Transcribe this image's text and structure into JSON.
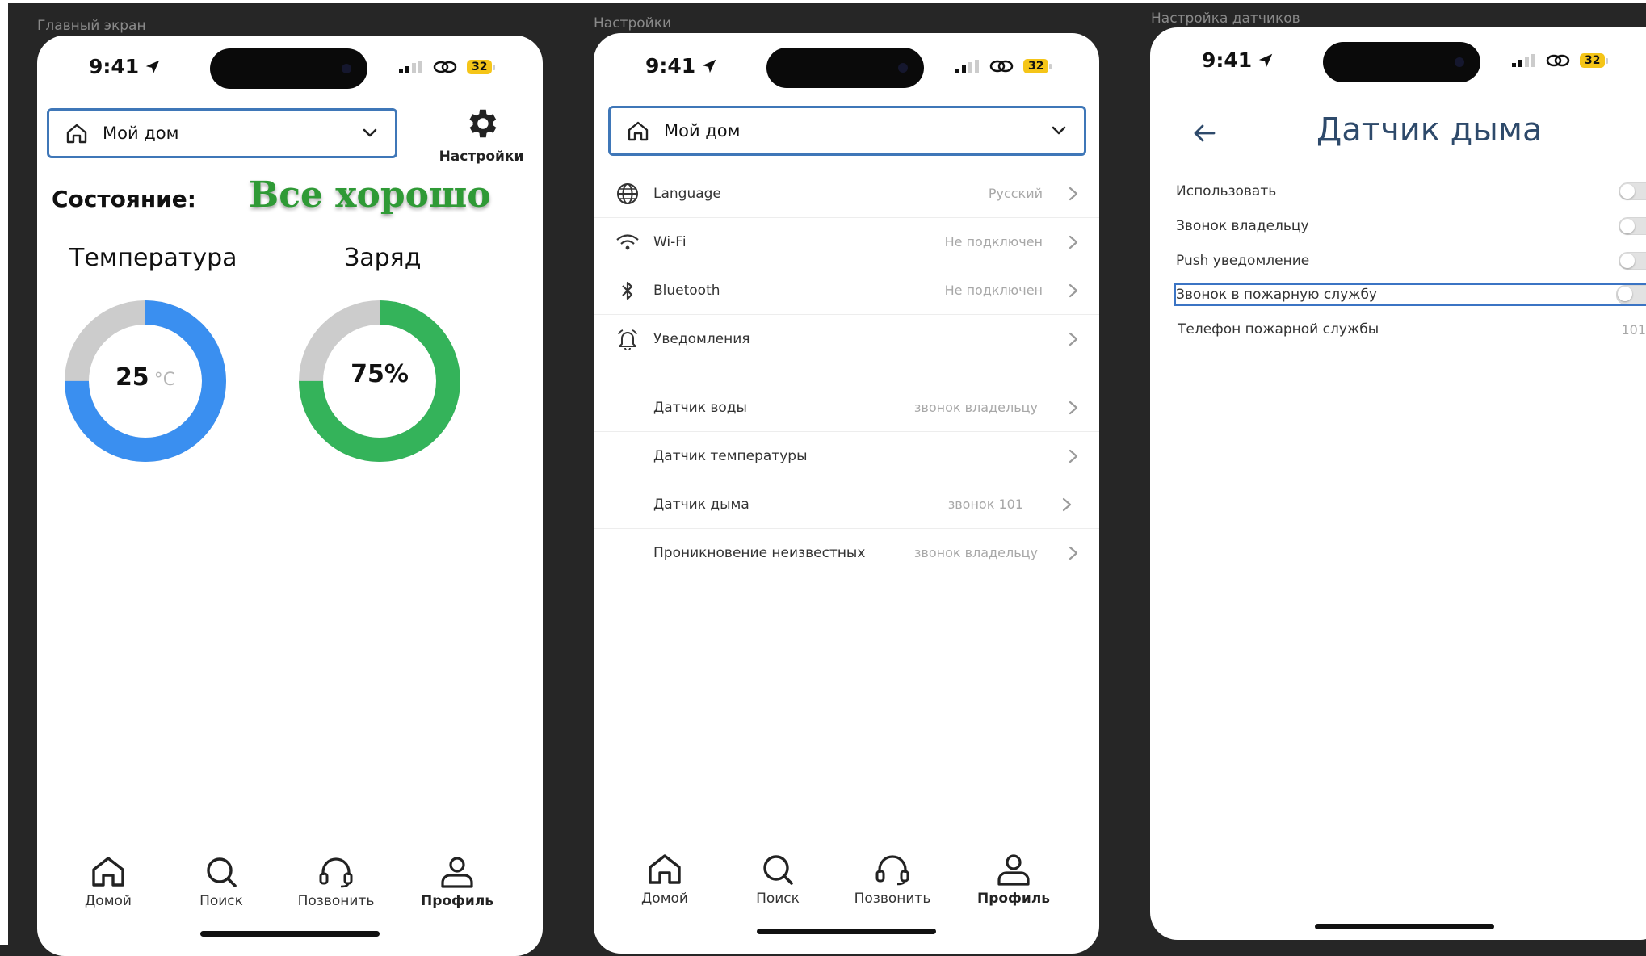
{
  "frames": [
    {
      "label": "Главный экран"
    },
    {
      "label": "Настройки"
    },
    {
      "label": "Настройка датчиков"
    }
  ],
  "status_bar": {
    "time": "9:41",
    "battery": "32"
  },
  "home_selector": {
    "label": "Мой дом"
  },
  "home": {
    "settings_label": "Настройки",
    "status_label": "Состояние:",
    "status_value": "Все хорошо",
    "status_color": "#2f9a36",
    "temperature": {
      "title": "Температура",
      "value": "25",
      "unit": "°C",
      "fraction": 0.75,
      "color": "#3a8ff0"
    },
    "charge": {
      "title": "Заряд",
      "value": "75%",
      "fraction": 0.75,
      "color": "#34b35a"
    },
    "track_color": "#cccccc"
  },
  "tabs": [
    {
      "label": "Домой",
      "icon": "home-icon"
    },
    {
      "label": "Поиск",
      "icon": "search-icon"
    },
    {
      "label": "Позвонить",
      "icon": "headset-icon"
    },
    {
      "label": "Профиль",
      "icon": "profile-icon"
    }
  ],
  "settings": {
    "rows": [
      {
        "label": "Language",
        "value": "Русский",
        "icon": "globe-icon"
      },
      {
        "label": "Wi-Fi",
        "value": "Не подключен",
        "icon": "wifi-icon"
      },
      {
        "label": "Bluetooth",
        "value": "Не подключен",
        "icon": "bluetooth-icon"
      },
      {
        "label": "Уведомления",
        "value": "",
        "icon": "bell-icon"
      }
    ],
    "sensors": [
      {
        "label": "Датчик воды",
        "value": "звонок владельцу"
      },
      {
        "label": "Датчик температуры",
        "value": ""
      },
      {
        "label": "Датчик дыма",
        "value": "звонок 101"
      },
      {
        "label": "Проникновение неизвестных",
        "value": "звонок владельцу"
      }
    ]
  },
  "sensor": {
    "title": "Датчик дыма",
    "options": [
      {
        "label": "Использовать",
        "enabled": false
      },
      {
        "label": "Звонок владельцу",
        "enabled": false
      },
      {
        "label": "Push уведомление",
        "enabled": false
      },
      {
        "label": "Звонок в пожарную службу",
        "enabled": false
      }
    ],
    "phone_label": "Телефон пожарной службы",
    "phone_value": "101"
  },
  "colors": {
    "accent": "#3f77b8",
    "title": "#2e4a6b",
    "background": "#262626"
  }
}
